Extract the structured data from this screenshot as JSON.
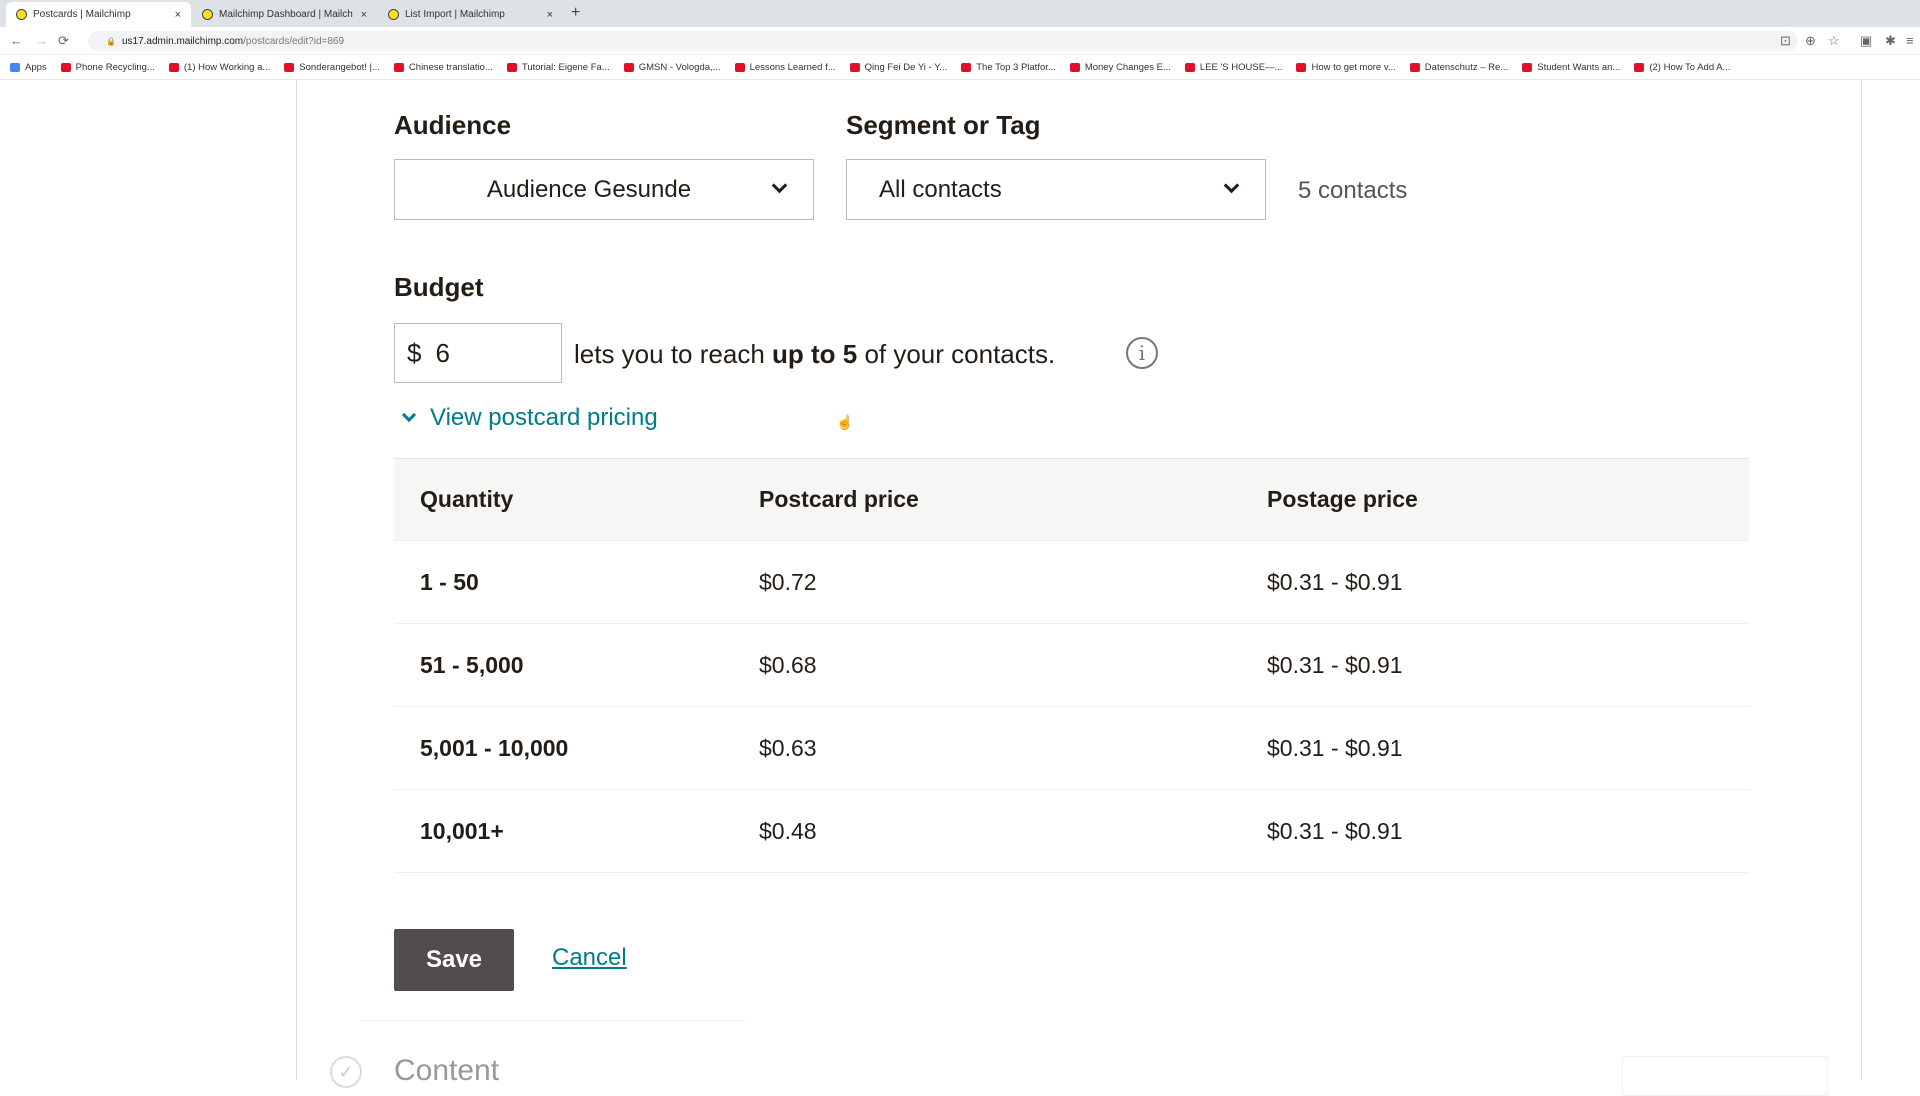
{
  "browser": {
    "tabs": [
      {
        "title": "Postcards | Mailchimp",
        "active": true
      },
      {
        "title": "Mailchimp Dashboard | Mailch",
        "active": false
      },
      {
        "title": "List Import | Mailchimp",
        "active": false
      }
    ],
    "new_tab": "+",
    "url_host": "us17.admin.mailchimp.com",
    "url_path": "/postcards/edit?id=869",
    "bookmarks": [
      "Apps",
      "Phone Recycling...",
      "(1) How Working a...",
      "Sonderangebot! |...",
      "Chinese translatio...",
      "Tutorial: Eigene Fa...",
      "GMSN - Vologda,...",
      "Lessons Learned f...",
      "Qing Fei De Yi - Y...",
      "The Top 3 Platfor...",
      "Money Changes E...",
      "LEE 'S HOUSE—...",
      "How to get more v...",
      "Datenschutz – Re...",
      "Student Wants an...",
      "(2) How To Add A..."
    ]
  },
  "audience": {
    "label": "Audience",
    "value": "Audience Gesunde"
  },
  "segment": {
    "label": "Segment or Tag",
    "value": "All contacts",
    "count": "5 contacts"
  },
  "budget": {
    "label": "Budget",
    "currency": "$",
    "value": "6",
    "text_before": "lets you to reach ",
    "text_bold": "up to 5",
    "text_after": " of your contacts."
  },
  "pricing_toggle": "View postcard pricing",
  "pricing_table": {
    "headers": [
      "Quantity",
      "Postcard price",
      "Postage price"
    ],
    "rows": [
      [
        "1 - 50",
        "$0.72",
        "$0.31 - $0.91"
      ],
      [
        "51 - 5,000",
        "$0.68",
        "$0.31 - $0.91"
      ],
      [
        "5,001 - 10,000",
        "$0.63",
        "$0.31 - $0.91"
      ],
      [
        "10,001+",
        "$0.48",
        "$0.31 - $0.91"
      ]
    ]
  },
  "actions": {
    "save": "Save",
    "cancel": "Cancel"
  },
  "next_section": {
    "title": "Content"
  },
  "colors": {
    "link": "#007c89",
    "save_button": "#514d4d",
    "brand": "#ffe01b"
  }
}
